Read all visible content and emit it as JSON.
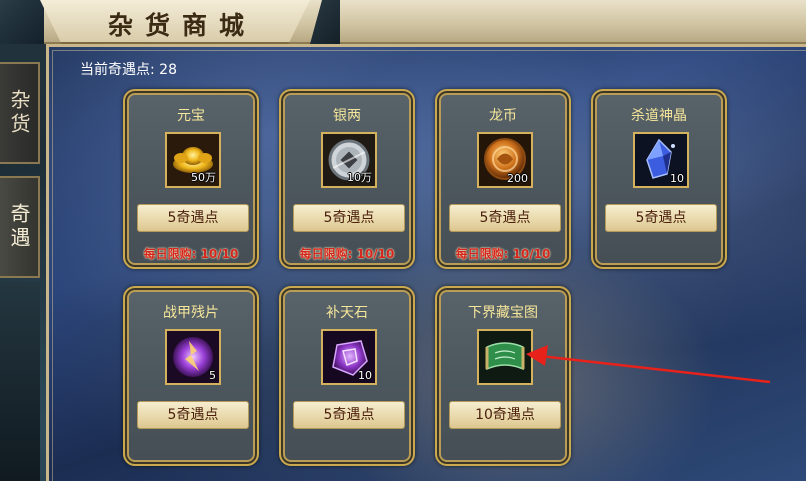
{
  "window": {
    "title": "杂货商城"
  },
  "side_tabs": [
    {
      "label": "杂货",
      "active": false
    },
    {
      "label": "奇遇",
      "active": true
    }
  ],
  "points": {
    "label": "当前奇遇点: 28"
  },
  "items": [
    {
      "name": "元宝",
      "icon": "gold-ingot-icon",
      "quantity": "50万",
      "price": "5奇遇点",
      "limit": "每日限购: 10/10"
    },
    {
      "name": "银两",
      "icon": "silver-coin-icon",
      "quantity": "10万",
      "price": "5奇遇点",
      "limit": "每日限购: 10/10"
    },
    {
      "name": "龙币",
      "icon": "dragon-coin-icon",
      "quantity": "200",
      "price": "5奇遇点",
      "limit": "每日限购: 10/10"
    },
    {
      "name": "杀道神晶",
      "icon": "blue-crystal-icon",
      "quantity": "10",
      "price": "5奇遇点",
      "limit": ""
    },
    {
      "name": "战甲残片",
      "icon": "purple-shard-icon",
      "quantity": "5",
      "price": "5奇遇点",
      "limit": ""
    },
    {
      "name": "补天石",
      "icon": "purple-stone-icon",
      "quantity": "10",
      "price": "5奇遇点",
      "limit": ""
    },
    {
      "name": "下界藏宝图",
      "icon": "treasure-map-icon",
      "quantity": "",
      "price": "10奇遇点",
      "limit": ""
    }
  ],
  "colors": {
    "item_name": "#f5e69a",
    "limit_text": "#d4261e",
    "price_text": "#4a1f0c",
    "card_border": "#caa84e",
    "annotation_arrow": "#e8221b"
  }
}
